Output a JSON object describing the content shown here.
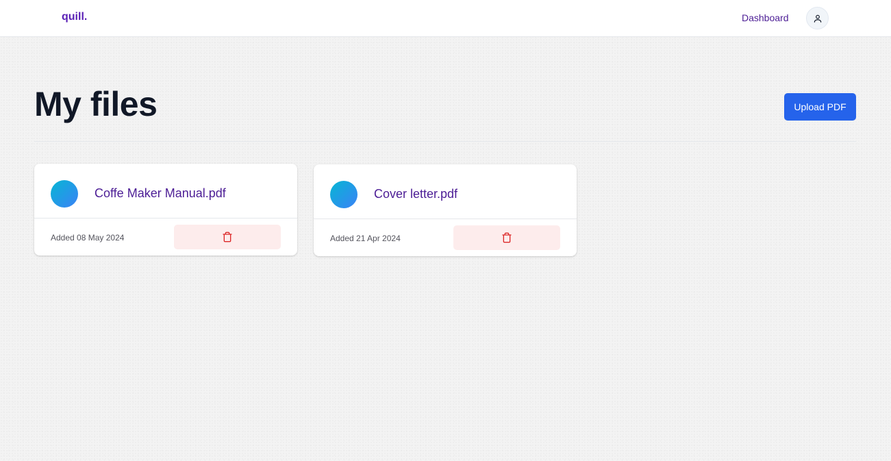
{
  "navbar": {
    "logo": "quill.",
    "dashboard_link": "Dashboard",
    "avatar_icon": "user-icon"
  },
  "main": {
    "title": "My files",
    "upload_button": "Upload PDF"
  },
  "files": [
    {
      "name": "Coffe Maker Manual.pdf",
      "added": "Added 08 May 2024",
      "delete_icon": "trash-icon"
    },
    {
      "name": "Cover letter.pdf",
      "added": "Added 21 Apr 2024",
      "delete_icon": "trash-icon"
    }
  ],
  "colors": {
    "brand": "#5b21b6",
    "primary_button": "#2563eb",
    "delete_background": "#fdecec",
    "delete_icon": "#dc2626"
  }
}
